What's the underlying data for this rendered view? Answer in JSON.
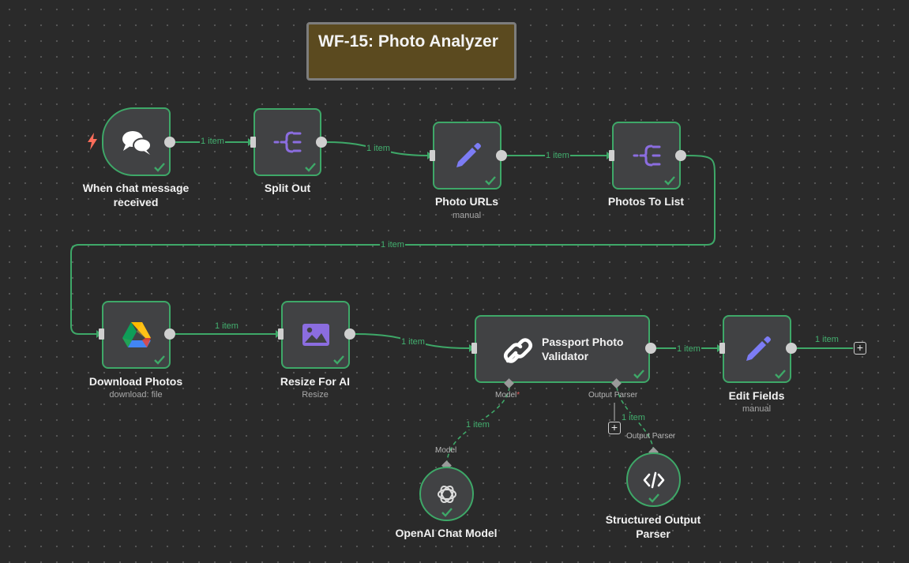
{
  "sticky_note": {
    "title": "WF-15: Photo Analyzer"
  },
  "connections": {
    "chat_to_split": "1 item",
    "split_to_urls": "1 item",
    "urls_to_list": "1 item",
    "list_to_download": "1 item",
    "download_to_resize": "1 item",
    "resize_to_validator": "1 item",
    "validator_to_edit": "1 item",
    "edit_output": "1 item",
    "model_link": "1 item",
    "parser_link": "1 item"
  },
  "nodes": {
    "chat_trigger": {
      "title_line1": "When chat message",
      "title_line2": "received",
      "icon": "chat-bubbles-icon"
    },
    "split_out": {
      "title": "Split Out",
      "icon": "split-icon"
    },
    "photo_urls": {
      "title": "Photo URLs",
      "subtitle": "manual",
      "icon": "pencil-icon"
    },
    "photos_to_list": {
      "title": "Photos To List",
      "icon": "split-icon"
    },
    "download_photos": {
      "title": "Download Photos",
      "subtitle": "download: file",
      "icon": "google-drive-icon"
    },
    "resize_for_ai": {
      "title": "Resize For AI",
      "subtitle": "Resize",
      "icon": "image-icon"
    },
    "passport_validator": {
      "title_line1": "Passport Photo",
      "title_line2": "Validator",
      "icon": "chain-link-icon",
      "port_model": "Model",
      "port_model_required": "*",
      "port_parser": "Output Parser"
    },
    "edit_fields": {
      "title": "Edit Fields",
      "subtitle": "manual",
      "icon": "pencil-icon"
    },
    "openai_model": {
      "title": "OpenAI Chat Model",
      "port_label": "Model",
      "icon": "openai-icon"
    },
    "output_parser": {
      "title_line1": "Structured Output",
      "title_line2": "Parser",
      "port_label": "Output Parser",
      "icon": "code-icon"
    }
  },
  "colors": {
    "canvas": "#2a2a2a",
    "node_fill": "#414244",
    "success_green": "#3ea868",
    "accent_purple": "#8b6de0",
    "pencil_blue": "#7c7cf5",
    "sticky_fill": "#5b4a1f",
    "trigger_bolt": "#ff6d5a"
  }
}
